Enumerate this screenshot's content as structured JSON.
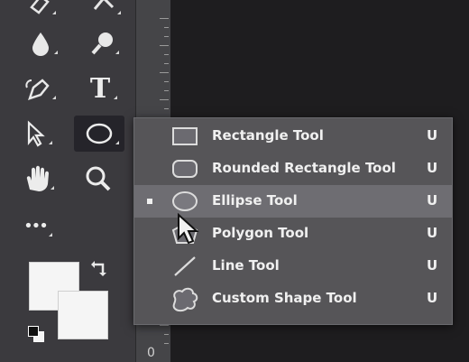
{
  "toolbar": {
    "tools": [
      {
        "name": "eraser",
        "icon": "eraser-icon"
      },
      {
        "name": "gradient",
        "icon": "gradient-icon"
      },
      {
        "name": "blur",
        "icon": "blur-drop-icon"
      },
      {
        "name": "dodge",
        "icon": "dodge-icon"
      },
      {
        "name": "pen",
        "icon": "pen-icon"
      },
      {
        "name": "type",
        "icon": "type-icon",
        "glyph": "T"
      },
      {
        "name": "path-selection",
        "icon": "path-selection-arrow-icon"
      },
      {
        "name": "ellipse",
        "icon": "ellipse-icon",
        "active": true
      },
      {
        "name": "hand",
        "icon": "hand-icon"
      },
      {
        "name": "zoom",
        "icon": "zoom-icon"
      },
      {
        "name": "edit-toolbar",
        "icon": "more-dots-icon",
        "glyph": "•••"
      }
    ]
  },
  "ruler": {
    "label": "0"
  },
  "flyout": {
    "items": [
      {
        "label": "Rectangle Tool",
        "shortcut": "U",
        "icon": "rectangle-icon",
        "selected": false
      },
      {
        "label": "Rounded Rectangle Tool",
        "shortcut": "U",
        "icon": "rounded-rectangle-icon",
        "selected": false
      },
      {
        "label": "Ellipse Tool",
        "shortcut": "U",
        "icon": "ellipse-icon",
        "selected": true
      },
      {
        "label": "Polygon Tool",
        "shortcut": "U",
        "icon": "polygon-icon",
        "selected": false
      },
      {
        "label": "Line Tool",
        "shortcut": "U",
        "icon": "line-icon",
        "selected": false
      },
      {
        "label": "Custom Shape Tool",
        "shortcut": "U",
        "icon": "custom-shape-icon",
        "selected": false
      }
    ]
  },
  "colors": {
    "foreground": "#f5f5f5",
    "background": "#f5f5f5",
    "menu_bg": "#565558",
    "menu_selected": "#6e6d72",
    "toolbar_bg": "#3b3a3e",
    "canvas_bg": "#1e1d1f"
  }
}
